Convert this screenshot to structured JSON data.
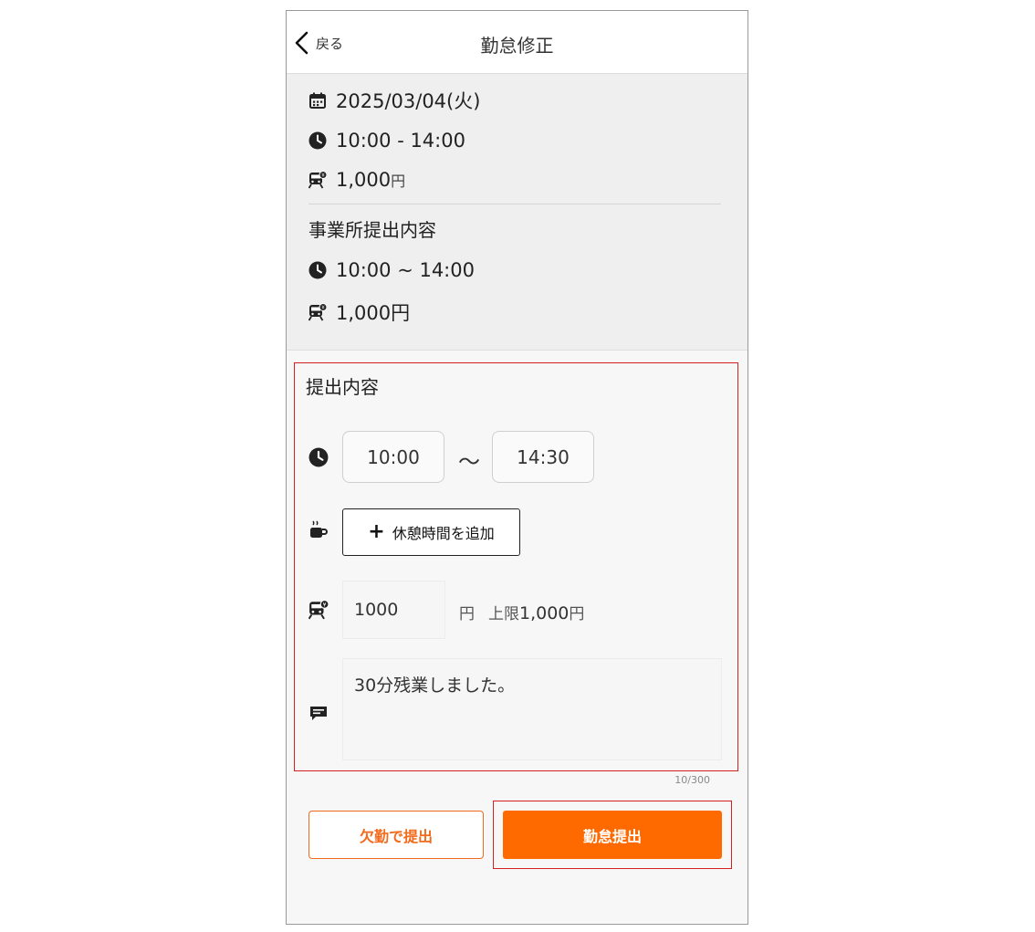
{
  "header": {
    "back_label": "戻る",
    "title": "勤怠修正"
  },
  "summary": {
    "date": "2025/03/04(火)",
    "time": "10:00 - 14:00",
    "fare": "1,000",
    "fare_unit": "円",
    "office_title": "事業所提出内容",
    "office_time": "10:00 ~ 14:00",
    "office_fare": "1,000円"
  },
  "form": {
    "title": "提出内容",
    "start_time": "10:00",
    "tilde": "〜",
    "end_time": "14:30",
    "add_break_label": "休憩時間を追加",
    "fare_value": "1000",
    "fare_unit": "円",
    "limit_prefix": "上限",
    "limit_value": "1,000",
    "limit_unit": "円",
    "memo": "30分残業しました。",
    "counter": "10/300"
  },
  "buttons": {
    "absence": "欠勤で提出",
    "submit": "勤怠提出"
  },
  "colors": {
    "accent": "#ff6a00",
    "highlight_border": "#d32020"
  },
  "icons": [
    "chevron-left-icon",
    "calendar-icon",
    "clock-icon",
    "train-icon",
    "coffee-icon",
    "comment-icon",
    "plus-icon"
  ]
}
